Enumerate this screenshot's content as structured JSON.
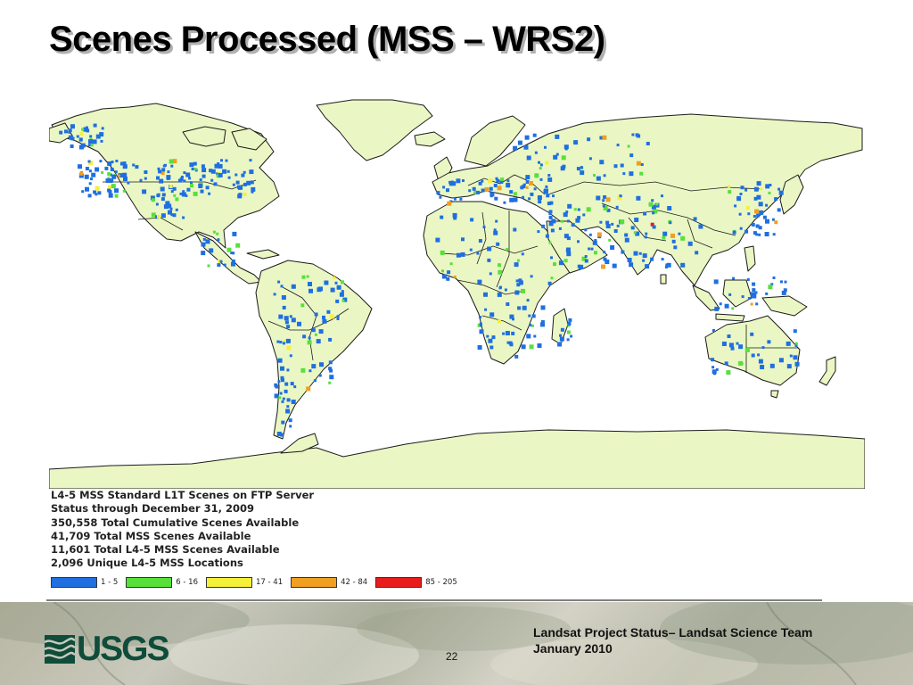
{
  "title": "Scenes Processed (MSS – WRS2)",
  "legend": {
    "lines": [
      "L4-5 MSS Standard L1T Scenes on FTP Server",
      "Status through December 31, 2009",
      "350,558 Total Cumulative Scenes Available",
      "41,709 Total MSS Scenes Available",
      "11,601 Total L4-5 MSS Scenes Available",
      "2,096 Unique L4-5 MSS Locations"
    ],
    "classes": [
      {
        "label": "1 - 5",
        "color": "#1f6fe0"
      },
      {
        "label": "6 - 16",
        "color": "#58e03a"
      },
      {
        "label": "17 - 41",
        "color": "#f5f03a"
      },
      {
        "label": "42 - 84",
        "color": "#f0a020"
      },
      {
        "label": "85 - 205",
        "color": "#e81c1c"
      }
    ]
  },
  "map": {
    "land_color": "#eaf7c4",
    "ocean_color": "#ffffff",
    "border_color": "#1a1a1a"
  },
  "footer": {
    "logo_text": "USGS",
    "logo_color": "#0f4c3a",
    "page_number": "22",
    "line1": "Landsat Project Status– Landsat Science Team",
    "line2": "January 2010"
  }
}
